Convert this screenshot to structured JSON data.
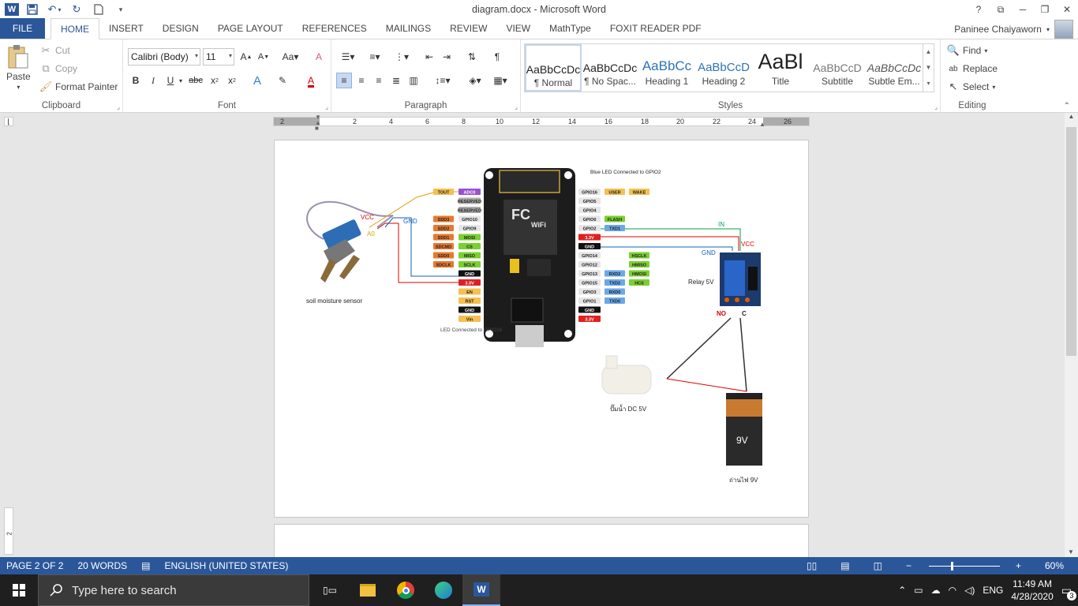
{
  "window": {
    "title": "diagram.docx - Microsoft Word",
    "controls": [
      "?",
      "⧉",
      "─",
      "❐",
      "✕"
    ]
  },
  "tabs": [
    "FILE",
    "HOME",
    "INSERT",
    "DESIGN",
    "PAGE LAYOUT",
    "REFERENCES",
    "MAILINGS",
    "REVIEW",
    "VIEW",
    "MathType",
    "FOXIT READER PDF"
  ],
  "user": {
    "name": "Paninee Chaiyaworn"
  },
  "clipboard": {
    "paste": "Paste",
    "cut": "Cut",
    "copy": "Copy",
    "format_painter": "Format Painter",
    "label": "Clipboard"
  },
  "font": {
    "family": "Calibri (Body)",
    "size": "11",
    "label": "Font"
  },
  "paragraph": {
    "label": "Paragraph"
  },
  "styles": {
    "label": "Styles",
    "items": [
      {
        "preview": "AaBbCcDc",
        "name": "¶ Normal"
      },
      {
        "preview": "AaBbCcDc",
        "name": "¶ No Spac..."
      },
      {
        "preview": "AaBbCc",
        "name": "Heading 1"
      },
      {
        "preview": "AaBbCcD",
        "name": "Heading 2"
      },
      {
        "preview": "AaBl",
        "name": "Title"
      },
      {
        "preview": "AaBbCcD",
        "name": "Subtitle"
      },
      {
        "preview": "AaBbCcDc",
        "name": "Subtle Em..."
      }
    ]
  },
  "editing": {
    "find": "Find",
    "replace": "Replace",
    "select": "Select",
    "label": "Editing"
  },
  "ruler": {
    "numbers": [
      "2",
      "2",
      "4",
      "6",
      "8",
      "10",
      "12",
      "14",
      "16",
      "18",
      "20",
      "22",
      "24",
      "26"
    ]
  },
  "diagram": {
    "soil_label": "soil moisture sensor",
    "vcc": "VCC",
    "gnd": "GND",
    "a0": "A0",
    "in": "IN",
    "no": "NO",
    "c": "C",
    "relay_label": "Relay 5V",
    "pump_label": "ปั๊มน้ำ DC 5V",
    "battery_label": "ถ่านไฟ 9V",
    "battery_text": "9V",
    "blue_led": "Blue LED Connected to GPIO2",
    "led_gpio16": "LED Connected to GPIO16",
    "board_text": "FC",
    "wifi_text": "WiFi",
    "left_pins": [
      {
        "a": "TOUT",
        "b": "ADC0"
      },
      {
        "a": "",
        "b": "RESERVED"
      },
      {
        "a": "",
        "b": "RESERVED"
      },
      {
        "a": "SDD3",
        "b": "GPIO10"
      },
      {
        "a": "SDD2",
        "b": "GPIO9"
      },
      {
        "a": "SDD1",
        "b": "MOSI"
      },
      {
        "a": "SDCMD",
        "b": "CS"
      },
      {
        "a": "SDD0",
        "b": "MISO"
      },
      {
        "a": "SDCLK",
        "b": "SCLK"
      },
      {
        "a": "",
        "b": "GND"
      },
      {
        "a": "",
        "b": "3.3V"
      },
      {
        "a": "",
        "b": "EN"
      },
      {
        "a": "",
        "b": "RST"
      },
      {
        "a": "",
        "b": "GND"
      },
      {
        "a": "",
        "b": "Vin"
      }
    ],
    "right_pins": [
      {
        "a": "GPIO16",
        "b": "USER",
        "c": "WAKE"
      },
      {
        "a": "GPIO5",
        "b": "",
        "c": ""
      },
      {
        "a": "GPIO4",
        "b": "",
        "c": ""
      },
      {
        "a": "GPIO0",
        "b": "FLASH",
        "c": ""
      },
      {
        "a": "GPIO2",
        "b": "TXD1",
        "c": ""
      },
      {
        "a": "3.3V",
        "b": "",
        "c": ""
      },
      {
        "a": "GND",
        "b": "",
        "c": ""
      },
      {
        "a": "GPIO14",
        "b": "",
        "c": "HSCLK"
      },
      {
        "a": "GPIO12",
        "b": "",
        "c": "HMISO"
      },
      {
        "a": "GPIO13",
        "b": "RXD2",
        "c": "HMOSI"
      },
      {
        "a": "GPIO15",
        "b": "TXD2",
        "c": "HCS"
      },
      {
        "a": "GPIO3",
        "b": "RXD0",
        "c": ""
      },
      {
        "a": "GPIO1",
        "b": "TXD0",
        "c": ""
      },
      {
        "a": "GND",
        "b": "",
        "c": ""
      },
      {
        "a": "3.3V",
        "b": "",
        "c": ""
      }
    ]
  },
  "status": {
    "page": "PAGE 2 OF 2",
    "words": "20 WORDS",
    "language": "ENGLISH (UNITED STATES)",
    "zoom": "60%"
  },
  "taskbar": {
    "search_placeholder": "Type here to search",
    "lang": "ENG",
    "time": "11:49 AM",
    "date": "4/28/2020",
    "notifications": "3"
  }
}
